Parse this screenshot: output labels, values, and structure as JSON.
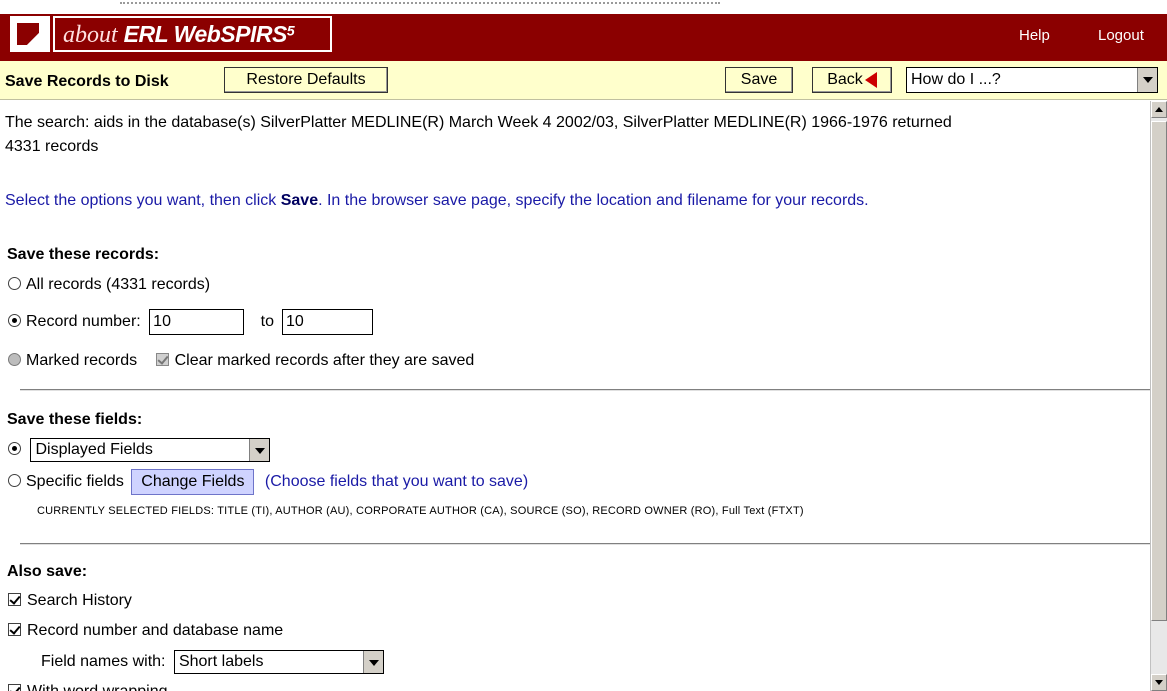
{
  "header": {
    "about": "about",
    "brand": "ERL WebSPIRS",
    "version": "5",
    "help": "Help",
    "logout": "Logout"
  },
  "toolbar": {
    "title": "Save Records to Disk",
    "restore_defaults": "Restore Defaults",
    "save": "Save",
    "back": "Back",
    "how_do_i": "How do I ...?"
  },
  "search_summary": {
    "line1": "The search: aids in the database(s) SilverPlatter MEDLINE(R) March Week 4 2002/03, SilverPlatter MEDLINE(R) 1966-1976 returned",
    "line2": "4331 records"
  },
  "instructions": {
    "pre": "Select the options you want, then click ",
    "bold": "Save",
    "post": ". In the browser save page, specify the location and filename for your records."
  },
  "records_section": {
    "heading": "Save these records:",
    "all_records": "All records (4331 records)",
    "record_number": "Record number:",
    "from_value": "10",
    "to_label": "to",
    "to_value": "10",
    "marked_records": "Marked records",
    "clear_marked": "Clear marked records after they are saved"
  },
  "fields_section": {
    "heading": "Save these fields:",
    "displayed_fields": "Displayed Fields",
    "specific_fields": "Specific fields",
    "change_fields": "Change Fields",
    "change_fields_hint": "(Choose fields that you want to save)",
    "currently_selected": "CURRENTLY SELECTED FIELDS: TITLE (TI), AUTHOR (AU), CORPORATE AUTHOR (CA), SOURCE (SO), RECORD OWNER (RO), Full Text (FTXT)"
  },
  "also_save": {
    "heading": "Also save:",
    "search_history": "Search History",
    "record_number_db": "Record number and database name",
    "field_names_with": "Field names with:",
    "field_names_value": "Short labels",
    "word_wrapping": "With word wrapping"
  },
  "colors": {
    "header_bg": "#8b0000",
    "toolbar_bg": "#ffffcc",
    "instruction_text": "#1a1aa6",
    "change_fields_bg": "#cfd3ff"
  }
}
